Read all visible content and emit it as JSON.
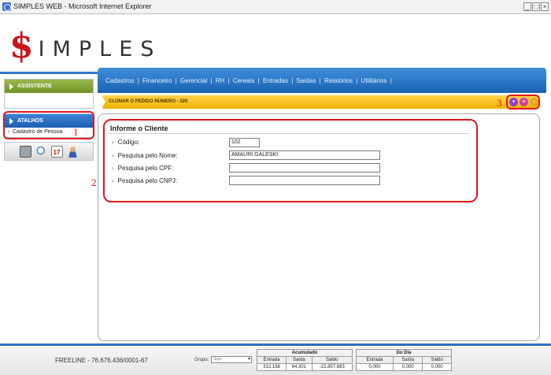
{
  "window": {
    "title": "SIMPLES WEB - Microsoft Internet Explorer",
    "buttons": [
      "_",
      "□",
      "×"
    ]
  },
  "logo": {
    "symbol": "$",
    "text": "IMPLES"
  },
  "nav": {
    "menu": [
      "Cadastros",
      "Financeiro",
      "Gerencial",
      "RH",
      "Cereais",
      "Entradas",
      "Saídas",
      "Relatórios",
      "Utilitários"
    ],
    "separator": "|"
  },
  "sidebar": {
    "assistente": "ASSISTENTE",
    "atalhos": "ATALHOS",
    "atalhos_items": [
      "Cadastro de Pessoa"
    ],
    "tools": [
      "calculator-icon",
      "search-icon",
      "calendar-icon",
      "user-icon"
    ],
    "calendar_day": "17"
  },
  "header": {
    "title": "CLONAR O PEDIDO NÚMERO - 320",
    "actions": [
      "add-icon",
      "cancel-icon",
      "confirm-icon"
    ]
  },
  "annotations": {
    "one": "1",
    "two": "2",
    "three": "3"
  },
  "form": {
    "title": "Informe o Cliente",
    "codigo_label": "Código:",
    "codigo_value": "102",
    "nome_label": "Pesquisa pelo Nome:",
    "nome_value": "AMAURI GALESKI",
    "cpf_label": "Pesquisa pelo CPF:",
    "cpf_value": "",
    "cnpj_label": "Pesquisa pelo CNPJ:",
    "cnpj_value": ""
  },
  "footer": {
    "company": "FREELINE - 76.676.436/0001-67",
    "grupo_label": "Grupo:",
    "grupo_value": "Soja",
    "acumulado": {
      "title": "Acumulado",
      "headers": [
        "Entrada",
        "Saída",
        "Saldo"
      ],
      "values": [
        "312,158",
        "64,301",
        "-22.857,683"
      ]
    },
    "dodia": {
      "title": "Do Dia",
      "headers": [
        "Entrada",
        "Saída",
        "Saldo"
      ],
      "values": [
        "0,000",
        "0,000",
        "0,000"
      ]
    }
  },
  "colors": {
    "accent": "#1f5fb0",
    "highlight": "#f0b200",
    "annotation": "#e0171e",
    "assistente": "#6f9426"
  }
}
